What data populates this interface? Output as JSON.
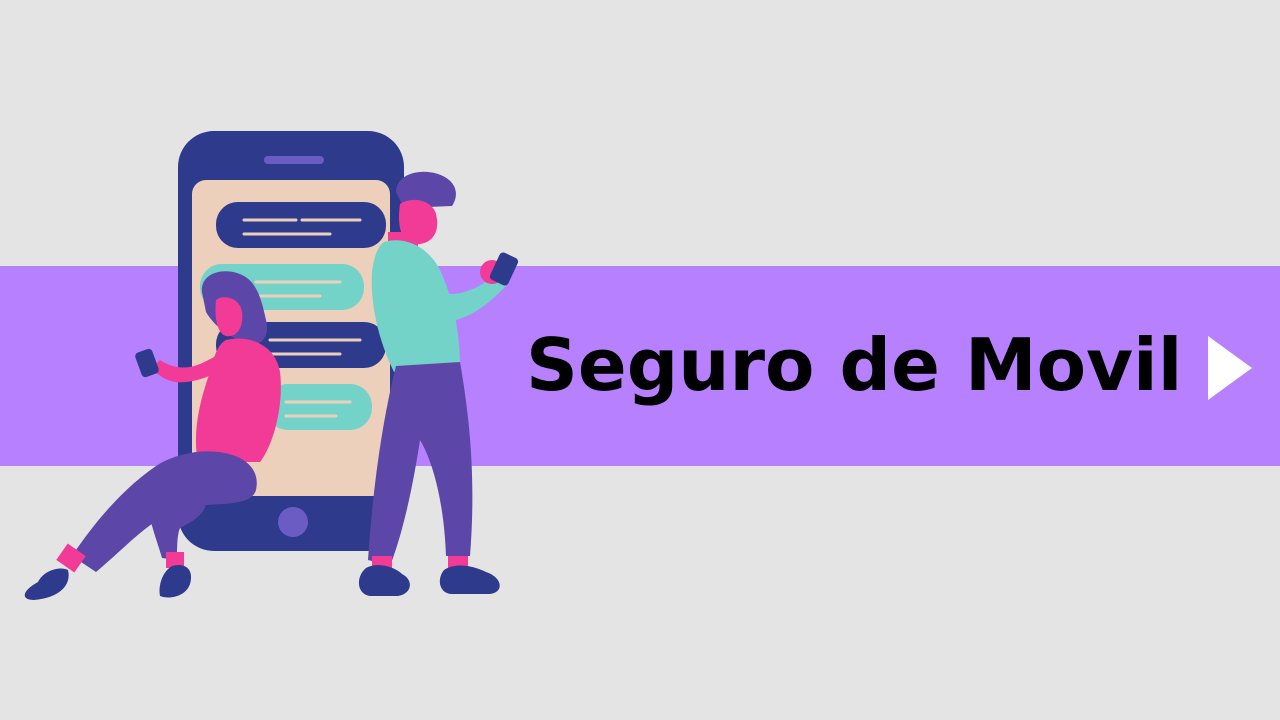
{
  "banner": {
    "title": "Seguro de Movil",
    "play_icon": "play-triangle-icon"
  },
  "illustration": {
    "subject": "smartphone-with-chat-bubbles",
    "people": [
      "woman-sitting-with-phone",
      "man-standing-with-phone"
    ]
  },
  "colors": {
    "background": "#e4e4e4",
    "band": "#b780ff",
    "phone_body": "#2e3a8c",
    "phone_screen": "#ecd0bb",
    "bubble_navy": "#2e3a8c",
    "bubble_mint": "#74d3c8",
    "skin_pink": "#f23b96",
    "shirt_mint": "#74d3c8",
    "pants_purple": "#5c47a8",
    "hair": "#5c47a8",
    "play_icon": "#ffffff",
    "title_text": "#000000"
  }
}
